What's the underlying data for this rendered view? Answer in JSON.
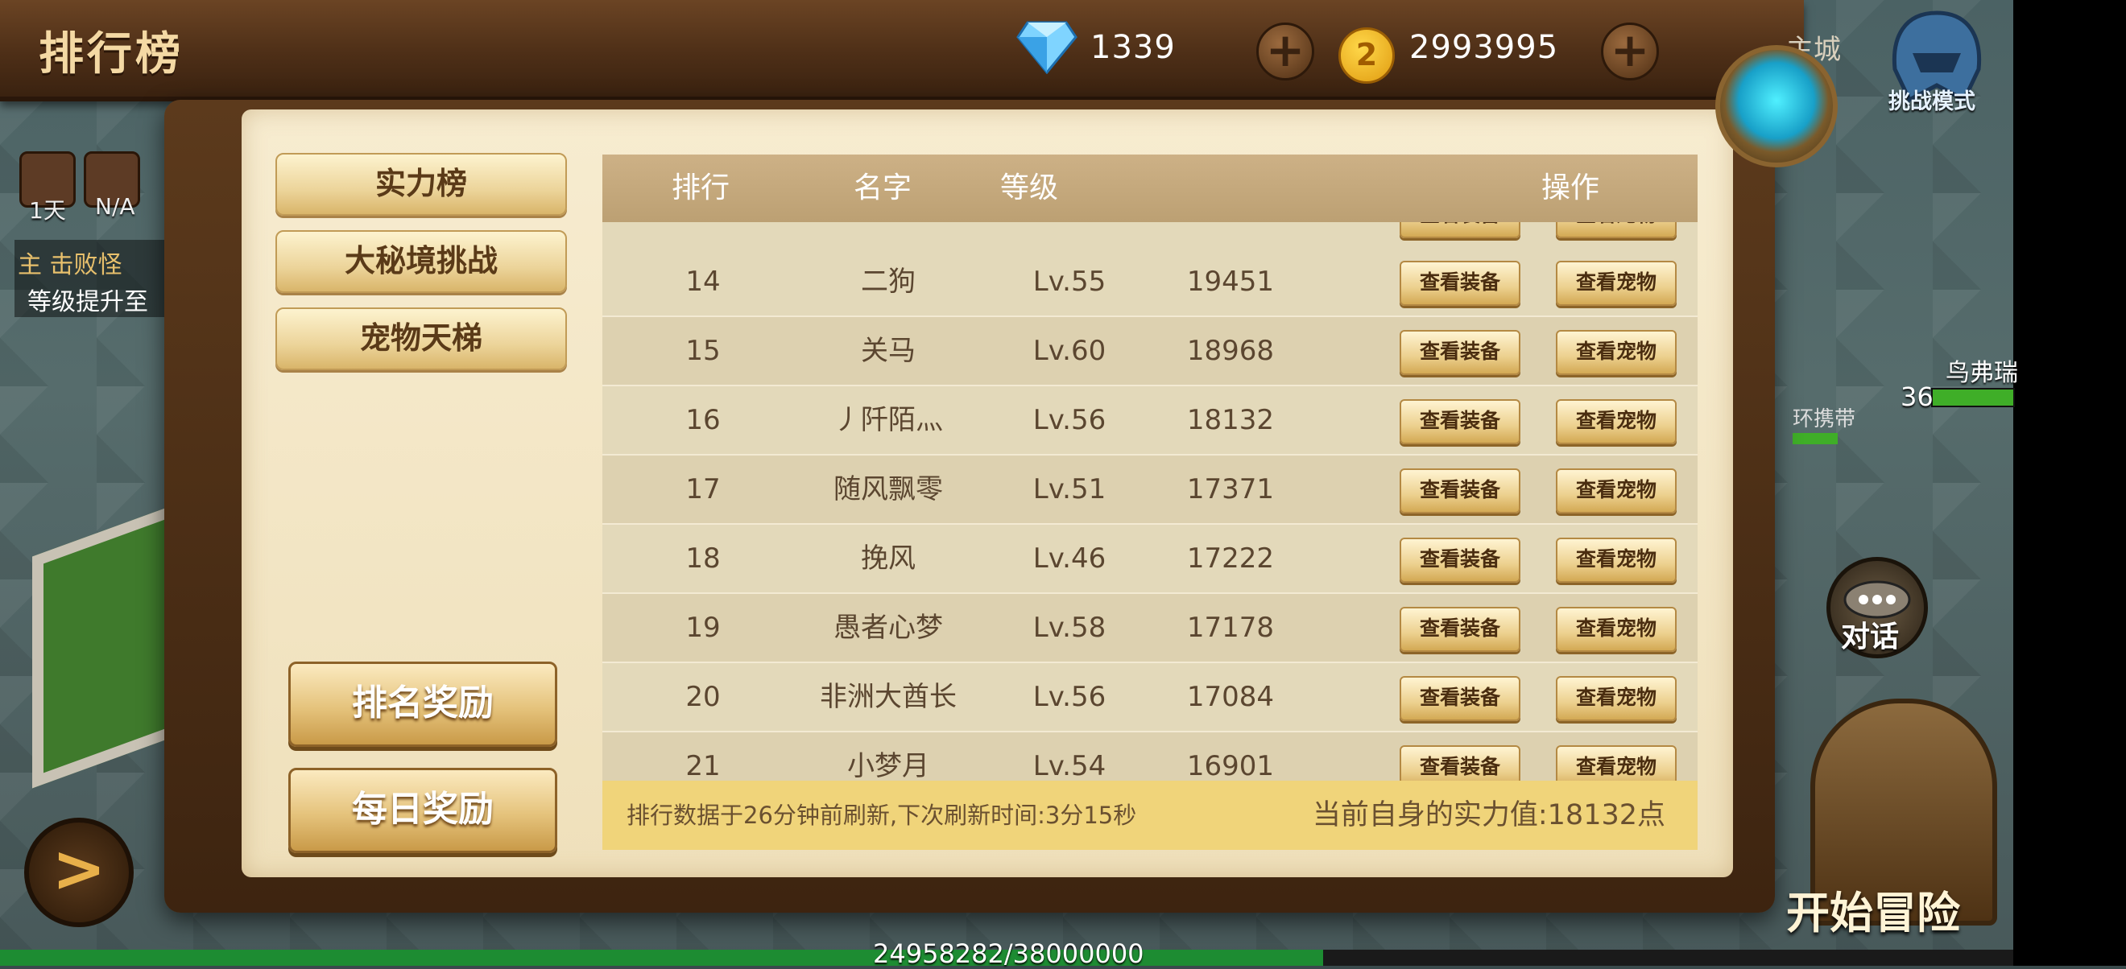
{
  "header": {
    "title": "排行榜",
    "gem_count": "1339",
    "gold_count": "2993995",
    "plus_label": "+",
    "coin_glyph": "2",
    "city_label": "主城",
    "challenge_mode": "挑战模式"
  },
  "hud": {
    "days": "1天",
    "na": "N/A",
    "quest_title": "主 击败怪",
    "quest_detail": "等级提升至",
    "chat": "对话",
    "adventure": "开始冒险",
    "npc_name": "鸟弗瑞",
    "npc_level": "36",
    "ring_text": "环携带",
    "exp_text": "24958282/38000000",
    "exp_fraction": 0.657,
    "back_glyph": ">"
  },
  "tabs": {
    "power": "实力榜",
    "secret_realm": "大秘境挑战",
    "pet_ladder": "宠物天梯"
  },
  "rewards": {
    "rank_reward": "排名奖励",
    "daily_reward": "每日奖励"
  },
  "table": {
    "headers": {
      "rank": "排行",
      "name": "名字",
      "level": "等级",
      "action": "操作"
    },
    "equip_btn": "查看装备",
    "pet_btn": "查看宠物",
    "rows": [
      {
        "rank": "14",
        "name": "二狗",
        "level": "Lv.55",
        "power": "19451"
      },
      {
        "rank": "15",
        "name": "关马",
        "level": "Lv.60",
        "power": "18968"
      },
      {
        "rank": "16",
        "name": "丿阡陌灬",
        "level": "Lv.56",
        "power": "18132"
      },
      {
        "rank": "17",
        "name": "随风飘零",
        "level": "Lv.51",
        "power": "17371"
      },
      {
        "rank": "18",
        "name": "挽风",
        "level": "Lv.46",
        "power": "17222"
      },
      {
        "rank": "19",
        "name": "愚者心梦",
        "level": "Lv.58",
        "power": "17178"
      },
      {
        "rank": "20",
        "name": "非洲大酋长",
        "level": "Lv.56",
        "power": "17084"
      },
      {
        "rank": "21",
        "name": "小梦月",
        "level": "Lv.54",
        "power": "16901"
      }
    ]
  },
  "footer": {
    "refresh_info": "排行数据于26分钟前刷新,下次刷新时间:3分15秒",
    "self_power": "当前自身的实力值:18132点"
  },
  "colors": {
    "accent_gold": "#f0d47a",
    "table_header": "#bca073",
    "text_brown": "#5b4630"
  },
  "icons": [
    "gem-icon",
    "coin-icon",
    "plus-icon",
    "back-arrow-icon",
    "chat-icon",
    "helmet-icon",
    "orb-icon"
  ]
}
